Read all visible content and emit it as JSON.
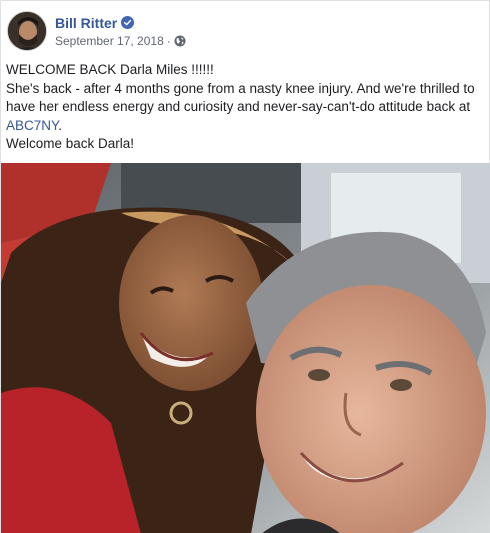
{
  "post": {
    "author": "Bill Ritter",
    "date": "September 17, 2018",
    "separator": "·",
    "icons": {
      "verified": "verified-badge-icon",
      "privacy": "globe-icon"
    },
    "colors": {
      "author_link": "#365899",
      "verified": "#4267b2",
      "meta_text": "#616770"
    },
    "body": {
      "line1": "WELCOME BACK Darla Miles !!!!!!",
      "line2_before_tag": "She's back - after 4 months gone from a nasty knee injury. And we're thrilled to have her endless energy and curiosity and never-say-can't-do attitude back at ",
      "hashtag": "ABC7NY",
      "line2_after_tag": ".",
      "line3": "Welcome back Darla!"
    },
    "photo_alt": "Selfie of two smiling people in an office"
  }
}
